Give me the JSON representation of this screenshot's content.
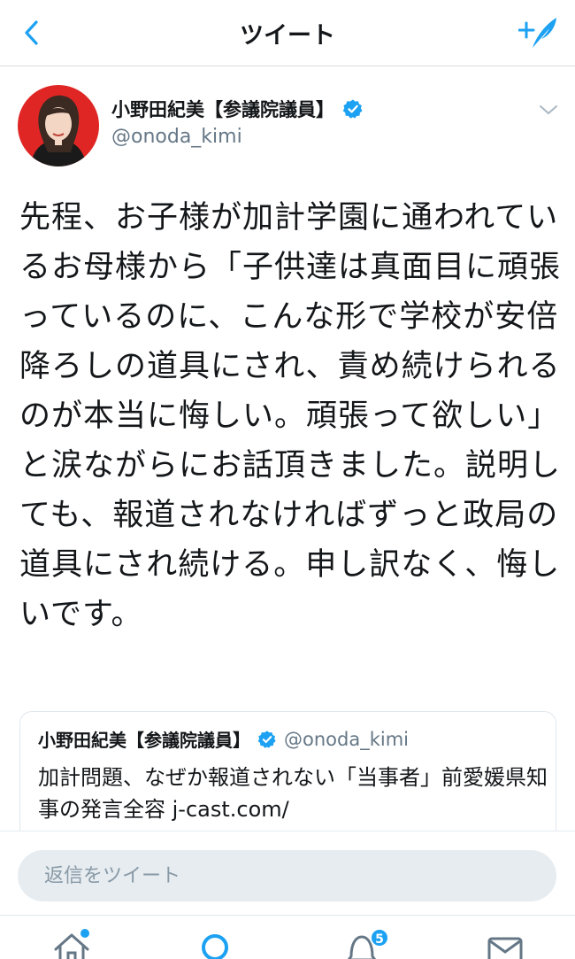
{
  "nav": {
    "title": "ツイート",
    "back_icon": "chevron-left-icon",
    "compose_icon": "compose-tweet-icon",
    "accent": "#1da1f2"
  },
  "tweet": {
    "display_name": "小野田紀美【参議院議員】",
    "handle": "@onoda_kimi",
    "verified": true,
    "text": "先程、お子様が加計学園に通われているお母様から「子供達は真面目に頑張っているのに、こんな形で学校が安倍降ろしの道具にされ、責め続けられるのが本当に悔しい。頑張って欲しい」と涙ながらにお話頂きました。説明しても、報道されなければずっと政局の道具にされ続ける。申し訳なく、悔しいです。"
  },
  "quote": {
    "display_name": "小野田紀美【参議院議員】",
    "handle": "@onoda_kimi",
    "text": "加計問題、なぜか報道されない「当事者」前愛媛県知事の発言全容 j-cast.com/"
  },
  "reply": {
    "placeholder": "返信をツイート"
  },
  "tabbar": {
    "notification_count": "5"
  },
  "colors": {
    "text": "#14171a",
    "secondary": "#657786",
    "verified": "#1da1f2",
    "reply_bg": "#e6ecf0"
  }
}
